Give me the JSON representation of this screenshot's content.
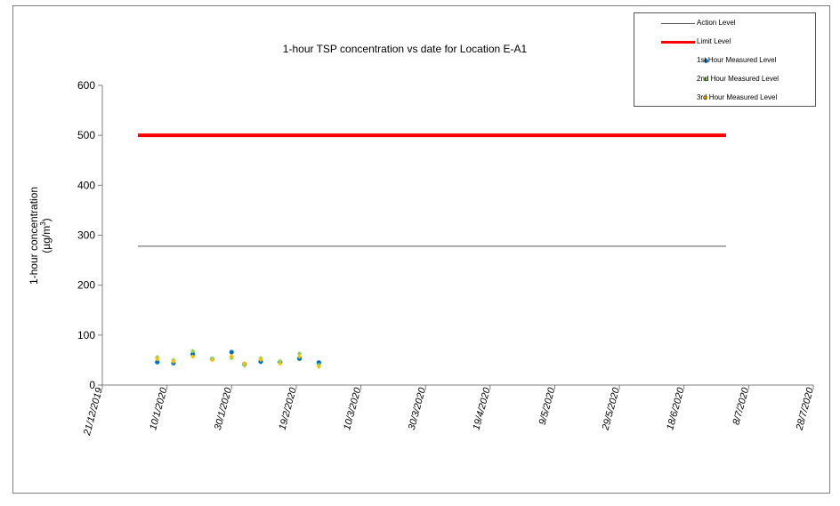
{
  "chart_data": {
    "type": "line",
    "title": "1-hour TSP concentration vs date for Location E-A1",
    "ylabel_line1": "1-hour concentration",
    "ylabel_line2_prefix": "(µg/m",
    "ylabel_line2_sup": "3",
    "ylabel_line2_suffix": ")",
    "ylim": [
      0,
      600
    ],
    "yticks": [
      0,
      100,
      200,
      300,
      400,
      500,
      600
    ],
    "xlim": [
      "2019-12-21",
      "2020-07-28"
    ],
    "xticks": [
      {
        "date": "2019-12-21",
        "label": "21/12/2019"
      },
      {
        "date": "2020-01-10",
        "label": "10/1/2020"
      },
      {
        "date": "2020-01-30",
        "label": "30/1/2020"
      },
      {
        "date": "2020-02-19",
        "label": "19/2/2020"
      },
      {
        "date": "2020-03-10",
        "label": "10/3/2020"
      },
      {
        "date": "2020-03-30",
        "label": "30/3/2020"
      },
      {
        "date": "2020-04-19",
        "label": "19/4/2020"
      },
      {
        "date": "2020-05-09",
        "label": "9/5/2020"
      },
      {
        "date": "2020-05-29",
        "label": "29/5/2020"
      },
      {
        "date": "2020-06-18",
        "label": "18/6/2020"
      },
      {
        "date": "2020-07-08",
        "label": "8/7/2020"
      },
      {
        "date": "2020-07-28",
        "label": "28/7/2020"
      }
    ],
    "grid": false,
    "legend_position": "top-right",
    "reference_lines": [
      {
        "name": "Action Level",
        "value": 278,
        "x_start": "2020-01-01",
        "x_end": "2020-07-01",
        "color": "#595959",
        "style": "thin"
      },
      {
        "name": "Limit Level",
        "value": 500,
        "x_start": "2020-01-01",
        "x_end": "2020-07-01",
        "color": "#ff0000",
        "style": "thick"
      }
    ],
    "series": [
      {
        "name": "1st Hour Measured Level",
        "color": "#0070c0",
        "marker": "circle",
        "x": [
          "2020-01-07",
          "2020-01-12",
          "2020-01-18",
          "2020-01-24",
          "2020-01-30",
          "2020-02-03",
          "2020-02-08",
          "2020-02-14",
          "2020-02-20",
          "2020-02-26"
        ],
        "y": [
          46,
          44,
          62,
          52,
          66,
          42,
          47,
          46,
          53,
          45
        ]
      },
      {
        "name": "2nd Hour Measured Level",
        "color": "#92d050",
        "marker": "diamond",
        "x": [
          "2020-01-07",
          "2020-01-12",
          "2020-01-18",
          "2020-01-24",
          "2020-01-30",
          "2020-02-03",
          "2020-02-08",
          "2020-02-14",
          "2020-02-20",
          "2020-02-26"
        ],
        "y": [
          56,
          50,
          68,
          53,
          54,
          39,
          54,
          48,
          63,
          40
        ]
      },
      {
        "name": "3rd Hour Measured Level",
        "color": "#ffc000",
        "marker": "diamond",
        "x": [
          "2020-01-07",
          "2020-01-12",
          "2020-01-18",
          "2020-01-24",
          "2020-01-30",
          "2020-02-03",
          "2020-02-08",
          "2020-02-14",
          "2020-02-20",
          "2020-02-26"
        ],
        "y": [
          52,
          47,
          57,
          50,
          58,
          43,
          51,
          43,
          57,
          37
        ]
      }
    ]
  }
}
